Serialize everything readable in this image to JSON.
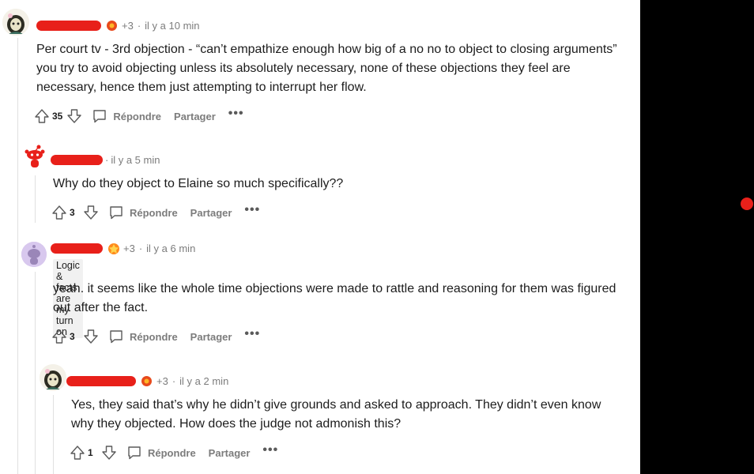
{
  "comments": [
    {
      "award_count": "+3",
      "time": "il y a 10 min",
      "body": "Per court tv - 3rd objection - “can’t empathize enough how big of a no no to object to closing arguments” you try to avoid objecting unless its absolutely necessary, none of these objections they feel are necessary, hence them just attempting to interrupt her flow.",
      "score": "35",
      "reply_label": "Répondre",
      "share_label": "Partager",
      "more_label": "•••"
    },
    {
      "time_prefix": "·",
      "time": "il y a 5 min",
      "body": "Why do they object to Elaine so much specifically??",
      "score": "3",
      "reply_label": "Répondre",
      "share_label": "Partager",
      "more_label": "•••"
    },
    {
      "award_count": "+3",
      "time": "il y a 6 min",
      "flair": "Logic & facts are my turn on",
      "body": "yeah. it seems like the whole time objections were made to rattle and reasoning for them was figured out after the fact.",
      "score": "3",
      "reply_label": "Répondre",
      "share_label": "Partager",
      "more_label": "•••"
    },
    {
      "award_count": "+3",
      "time": "il y a 2 min",
      "body": "Yes, they said that’s why he didn’t give grounds and asked to approach. They didn’t even know why they objected. How does the judge not admonish this?",
      "score": "1",
      "reply_label": "Répondre",
      "share_label": "Partager",
      "more_label": "•••"
    }
  ],
  "colors": {
    "redaction": "#e8201a",
    "meta_text": "#7c7c7c",
    "body_text": "#1c1c1c",
    "panel": "#000000"
  }
}
